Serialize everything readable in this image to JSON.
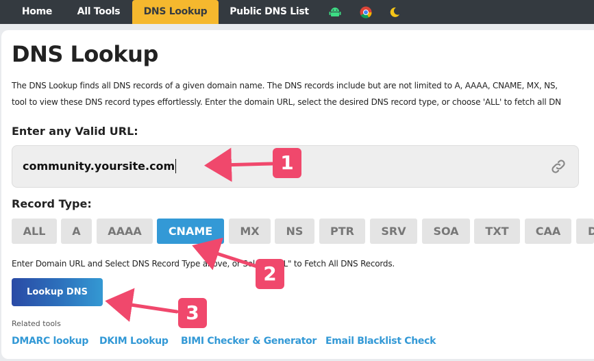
{
  "nav": {
    "items": [
      "Home",
      "All Tools",
      "DNS Lookup",
      "Public DNS List"
    ],
    "active": "DNS Lookup",
    "icons": [
      "android-icon",
      "chrome-icon",
      "moon-icon"
    ]
  },
  "page": {
    "title": "DNS Lookup",
    "desc_line1": "The DNS Lookup finds all DNS records of a given domain name. The DNS records include but are not limited to A, AAAA, CNAME, MX, NS,",
    "desc_line2": "tool to view these DNS record types effortlessly. Enter the domain URL, select the desired DNS record type, or choose 'ALL' to fetch all DN"
  },
  "url_field": {
    "label": "Enter any Valid URL:",
    "value": "community.yoursite.com"
  },
  "record_type": {
    "label": "Record Type:",
    "options": [
      "ALL",
      "A",
      "AAAA",
      "CNAME",
      "MX",
      "NS",
      "PTR",
      "SRV",
      "SOA",
      "TXT",
      "CAA",
      "D"
    ],
    "selected": "CNAME"
  },
  "hint": "Enter Domain URL and Select DNS Record Type above, or Select \"ALL\" to Fetch All DNS Records.",
  "lookup_button": "Lookup DNS",
  "related": {
    "label": "Related tools",
    "links": [
      "DMARC lookup",
      "DKIM Lookup",
      "BIMI Checker & Generator",
      "Email Blacklist Check"
    ]
  },
  "annotations": [
    "1",
    "2",
    "3"
  ],
  "colors": {
    "nav_bg": "#343a40",
    "nav_active": "#f5b82e",
    "accent": "#3399d6",
    "annotation": "#f0486c"
  }
}
